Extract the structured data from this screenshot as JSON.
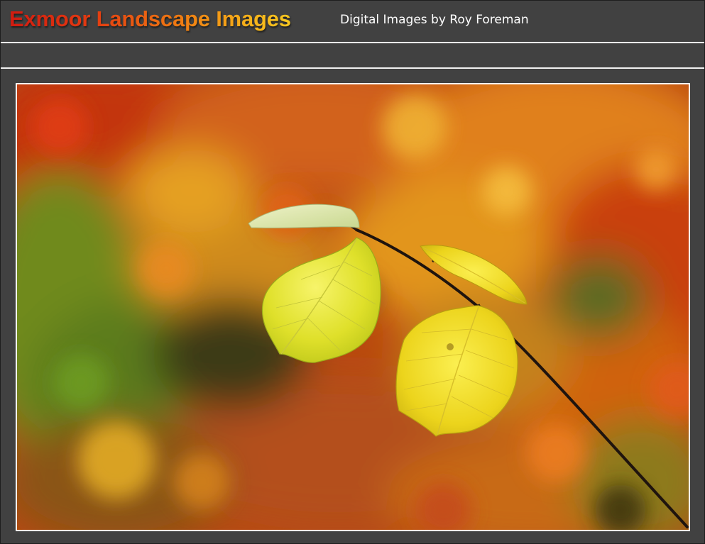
{
  "header": {
    "title": "Exmoor Landscape Images",
    "subtitle": "Digital Images by Roy Foreman"
  },
  "photo": {
    "subject": "autumn-leaves-photo",
    "colors": {
      "background_warm": "#c44a10",
      "background_orange": "#e07a18",
      "background_green": "#5f7a1e",
      "leaf_yellow": "#e8e01c",
      "twig": "#2a1c14"
    }
  }
}
